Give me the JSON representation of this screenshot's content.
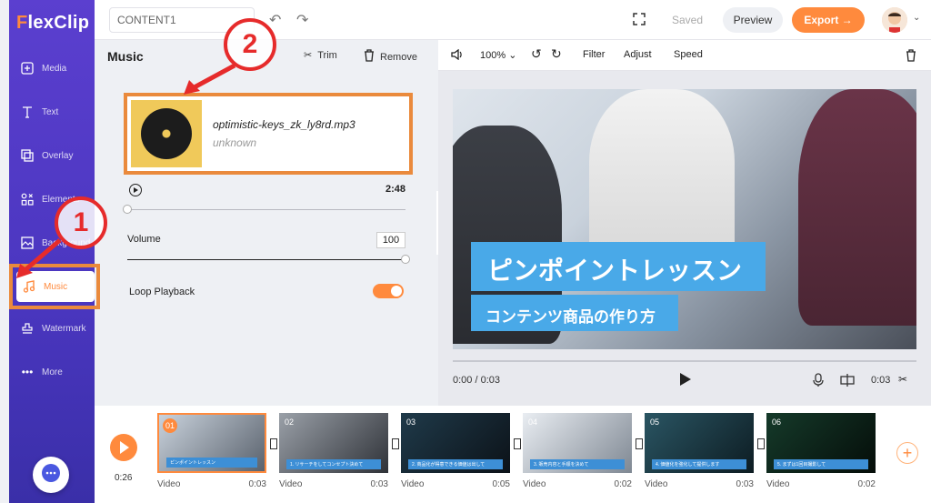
{
  "app": {
    "logo": "FlexClip"
  },
  "sidebar": {
    "items": [
      {
        "label": "Media",
        "icon": "media-icon"
      },
      {
        "label": "Text",
        "icon": "text-icon"
      },
      {
        "label": "Overlay",
        "icon": "overlay-icon"
      },
      {
        "label": "Elements",
        "icon": "elements-icon"
      },
      {
        "label": "Background",
        "icon": "background-icon"
      },
      {
        "label": "Music",
        "icon": "music-icon",
        "active": true
      },
      {
        "label": "Watermark",
        "icon": "watermark-icon"
      },
      {
        "label": "More",
        "icon": "more-icon"
      }
    ]
  },
  "topbar": {
    "project_name": "CONTENT1",
    "saved_label": "Saved",
    "preview_label": "Preview",
    "export_label": "Export →"
  },
  "panel": {
    "title": "Music",
    "trim_label": "Trim",
    "remove_label": "Remove",
    "track": {
      "filename": "optimistic-keys_zk_ly8rd.mp3",
      "artist": "unknown",
      "duration": "2:48"
    },
    "volume_label": "Volume",
    "volume_value": "100",
    "loop_label": "Loop Playback",
    "loop_on": true
  },
  "preview": {
    "toolbar": {
      "zoom": "100%",
      "filter": "Filter",
      "adjust": "Adjust",
      "speed": "Speed"
    },
    "title_text": "ピンポイントレッスン",
    "subtitle_text": "コンテンツ商品の作り方",
    "time_current": "0:00 / 0:03",
    "time_total": "0:03"
  },
  "timeline": {
    "total_time": "0:26",
    "clips": [
      {
        "num": "01",
        "type": "Video",
        "duration": "0:03",
        "caption": "ピンポイントレッスン",
        "selected": true
      },
      {
        "num": "02",
        "type": "Video",
        "duration": "0:03",
        "caption": "1. リサーチをしてコンセプト決めて"
      },
      {
        "num": "03",
        "type": "Video",
        "duration": "0:05",
        "caption": "2. 商品化が得意できる価値は出して"
      },
      {
        "num": "04",
        "type": "Video",
        "duration": "0:02",
        "caption": "3. 販売内容と手順を決めて"
      },
      {
        "num": "05",
        "type": "Video",
        "duration": "0:03",
        "caption": "4. 価値化を強化して提供します"
      },
      {
        "num": "06",
        "type": "Video",
        "duration": "0:02",
        "caption": "5. まずは1回目撮影して"
      }
    ]
  },
  "annotations": {
    "step1": "1",
    "step2": "2"
  },
  "colors": {
    "accent": "#ff8a3d",
    "sidebar": "#4a36bf",
    "annotation": "#e62b2b"
  }
}
